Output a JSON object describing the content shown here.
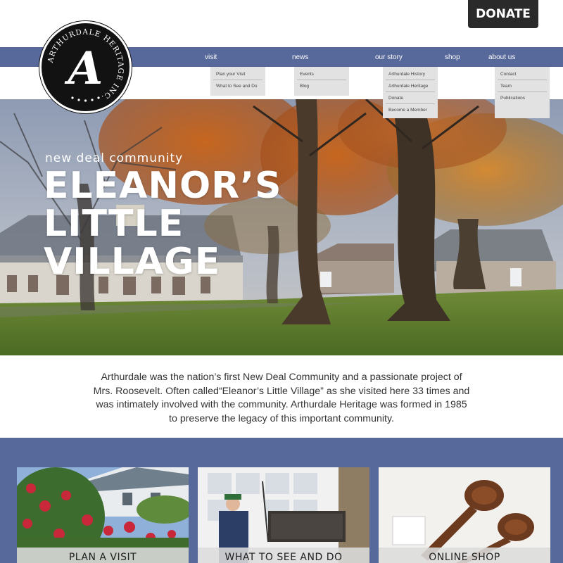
{
  "donate_label": "DONATE",
  "logo": {
    "letter": "A",
    "ring_text": "ARTHURDALE HERITAGE INC."
  },
  "nav": {
    "items": [
      "visit",
      "news",
      "our story",
      "shop",
      "about us"
    ],
    "dropdowns": {
      "visit": [
        "Plan your Visit",
        "What to See and Do"
      ],
      "news": [
        "Events",
        "Blog"
      ],
      "our_story": [
        "Arthurdale History",
        "Arthurdale Heritage",
        "Donate",
        "Become a Member"
      ],
      "about_us": [
        "Contact",
        "Team",
        "Publications"
      ]
    }
  },
  "hero": {
    "kicker": "new deal community",
    "title_lines": [
      "ELEANOR’S",
      "LITTLE",
      "VILLAGE"
    ]
  },
  "intro_text": "Arthurdale was the nation’s first New Deal Community and a passionate project of Mrs. Roosevelt. Often called“Eleanor’s Little Village” as she visited here 33 times and was intimately involved with the community.  Arthurdale Heritage was formed in 1985 to preserve the legacy of this important community.",
  "cards": [
    {
      "label": "PLAN A VISIT"
    },
    {
      "label": "WHAT TO SEE AND DO"
    },
    {
      "label": "ONLINE SHOP"
    }
  ],
  "colors": {
    "nav_blue": "#57689a",
    "donate_bg": "#2a2a2a",
    "dropdown_bg": "#e2e2e2"
  }
}
